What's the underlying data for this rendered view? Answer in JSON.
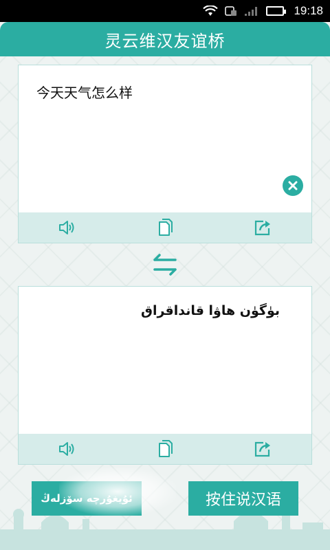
{
  "status_bar": {
    "time": "19:18"
  },
  "header": {
    "title": "灵云维汉友谊桥"
  },
  "source_panel": {
    "text": "今天天气怎么样"
  },
  "target_panel": {
    "text": "بۈگۈن ھاۋا قانداقراق"
  },
  "buttons": {
    "uyghur_label": "ئۇيغۇرچە سۆزلەڭ",
    "chinese_label": "按住说汉语"
  },
  "colors": {
    "accent": "#2bada2",
    "toolbar": "#d6ecea"
  }
}
